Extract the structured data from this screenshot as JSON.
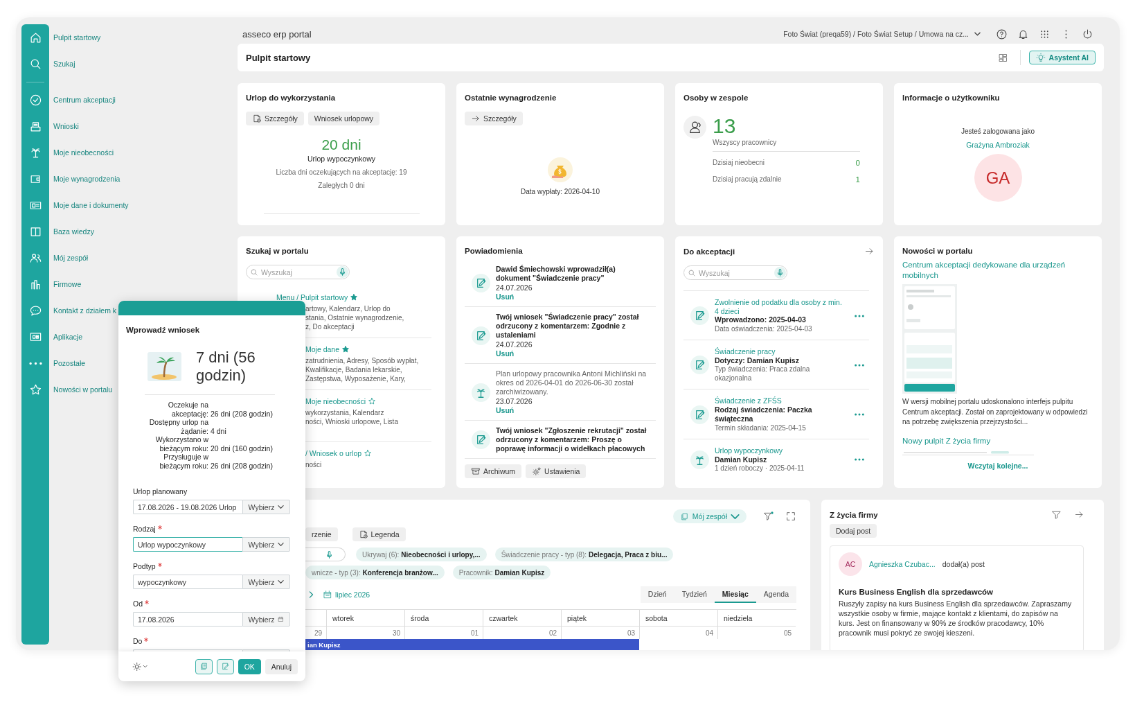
{
  "sidebar": {
    "items": [
      {
        "label": "Pulpit startowy"
      },
      {
        "label": "Szukaj"
      },
      {
        "label": "Centrum akceptacji"
      },
      {
        "label": "Wnioski"
      },
      {
        "label": "Moje nieobecności"
      },
      {
        "label": "Moje wynagrodzenia"
      },
      {
        "label": "Moje dane i dokumenty"
      },
      {
        "label": "Baza wiedzy"
      },
      {
        "label": "Mój zespół"
      },
      {
        "label": "Firmowe"
      },
      {
        "label": "Kontakt z działem k"
      },
      {
        "label": "Aplikacje"
      },
      {
        "label": "Pozostałe"
      },
      {
        "label": "Nowości w portalu"
      }
    ]
  },
  "topbar": {
    "logo": "asseco erp portal",
    "context": "Foto Świat (preqa59) / Foto Świat Setup / Umowa na cz..."
  },
  "header": {
    "title": "Pulpit startowy",
    "assistant_button": "Asystent AI"
  },
  "leave_card": {
    "title": "Urlop do wykorzystania",
    "details_button": "Szczegóły",
    "request_button": "Wniosek urlopowy",
    "amount": "20 dni",
    "type": "Urlop wypoczynkowy",
    "pending": "Liczba dni oczekujących na akceptację: 19",
    "overdue": "Zaległych 0 dni"
  },
  "salary_card": {
    "title": "Ostatnie wynagrodzenie",
    "details_button": "Szczegóły",
    "payday": "Data wypłaty: 2026-04-10"
  },
  "team_card": {
    "title": "Osoby w zespole",
    "count": "13",
    "count_label": "Wszyscy pracownicy",
    "stats": [
      {
        "label": "Dzisiaj nieobecni",
        "value": "0"
      },
      {
        "label": "Dzisiaj pracują zdalnie",
        "value": "1"
      }
    ]
  },
  "user_card": {
    "title": "Informacje o użytkowniku",
    "caption": "Jesteś zalogowana jako",
    "name": "Grażyna Ambroziak",
    "initials": "GA"
  },
  "portal_search": {
    "title": "Szukaj w portalu",
    "placeholder": "Wyszukaj",
    "results": [
      {
        "title": "Menu / Pulpit startowy",
        "favorite": true,
        "description": "artowy, Kalendarz, Urlop do\nstania, Ostatnie wynagrodzenie,\nz, Do akceptacji"
      },
      {
        "title": "Moje dane",
        "favorite": true,
        "description": "zatrudnienia, Adresy, Sposób wypłat,\nKwalifikacje, Badania lekarskie,\nZastępstwa, Wyposażenie, Kary,"
      },
      {
        "title": "Moje nieobecności",
        "favorite": false,
        "description": "wykorzystania, Kalendarz\nności, Wnioski urlopowe, Lista"
      },
      {
        "title": "/ Wniosek o urlop",
        "favorite": false,
        "description": "ności"
      }
    ]
  },
  "notifications": {
    "title": "Powiadomienia",
    "items": [
      {
        "kind": "document",
        "text": "Dawid Śmiechowski wprowadził(a) dokument \"Świadczenie pracy\"",
        "date": "24.07.2026",
        "action": "Usuń",
        "read": false
      },
      {
        "kind": "document",
        "text": "Twój wniosek \"Świadczenie pracy\" został odrzucony z komentarzem: Zgodnie z ustaleniami",
        "date": "24.07.2026",
        "action": "Usuń",
        "read": false
      },
      {
        "kind": "leave",
        "text": "Plan urlopowy pracownika Antoni Michliński na okres od 2026-04-01 do 2026-06-30 został zarchiwizowany.",
        "date": "23.07.2026",
        "action": "Usuń",
        "read": true
      },
      {
        "kind": "document",
        "text": "Twój wniosek \"Zgłoszenie rekrutacji\" został odrzucony z komentarzem: Proszę o poprawę informacji o widełkach płacowych",
        "read": false
      }
    ],
    "archive_button": "Archiwum",
    "settings_button": "Ustawienia"
  },
  "approvals": {
    "title": "Do akceptacji",
    "placeholder": "Wyszukaj",
    "items": [
      {
        "kind": "document",
        "title": "Zwolnienie od podatku dla osoby z min. 4 dzieci",
        "subtitle": "Wprowadzono: 2025-04-03",
        "detail": "Data oświadczenia: 2025-04-03"
      },
      {
        "kind": "document",
        "title": "Świadczenie pracy",
        "subtitle": "Dotyczy: Damian Kupisz",
        "detail": "Typ świadczenia: Praca zdalna okazjonalna"
      },
      {
        "kind": "document",
        "title": "Świadczenie z ZFŚS",
        "subtitle": "Rodzaj świadczenia: Paczka świąteczna",
        "detail": "Termin składania: 2025-04-15"
      },
      {
        "kind": "leave",
        "title": "Urlop wypoczynkowy",
        "subtitle": "Damian Kupisz",
        "detail": "1 dzień roboczy · 2025-04-11"
      }
    ]
  },
  "news": {
    "title": "Nowości w portalu",
    "items": [
      {
        "title": "Centrum akceptacji dedykowane dla urządzeń mobilnych",
        "summary": "W wersji mobilnej portalu udoskonalono interfejs pulpitu Centrum akceptacji. Został on zaprojektowany w odpowiedzi na potrzebę zwiększenia przejrzystości..."
      },
      {
        "title": "Nowy pulpit Z życia firmy"
      }
    ],
    "more": "Wczytaj kolejne..."
  },
  "calendar": {
    "team_filter": "Mój zespół",
    "highlight_button": "rzenie",
    "legend_button": "Legenda",
    "filters": [
      {
        "label": "Ukrywaj (6):",
        "value": "Nieobecności i urlopy,..."
      },
      {
        "label": "Świadczenie pracy - typ (8):",
        "value": "Delegacja, Praca z biu..."
      },
      {
        "label": "wnicze - typ (3):",
        "value": "Konferencja branżow..."
      },
      {
        "label": "Pracownik:",
        "value": "Damian Kupisz"
      }
    ],
    "month": "lipiec 2026",
    "views": [
      {
        "label": "Dzień",
        "selected": false
      },
      {
        "label": "Tydzień",
        "selected": false
      },
      {
        "label": "Miesiąc",
        "selected": true
      },
      {
        "label": "Agenda",
        "selected": false
      }
    ],
    "weekdays": [
      "wtorek",
      "środa",
      "czwartek",
      "piątek",
      "sobota",
      "niedziela"
    ],
    "days": [
      "29",
      "30",
      "01",
      "02",
      "03",
      "04",
      "05"
    ],
    "event": "ian Kupisz"
  },
  "company_life": {
    "title": "Z życia firmy",
    "add_button": "Dodaj post",
    "post": {
      "initials": "AC",
      "author": "Agnieszka Czubac...",
      "action": "dodał(a) post",
      "title": "Kurs Business English dla sprzedawców",
      "body": "Ruszyły zapisy na kurs Business English dla sprzedawców. Zapraszamy wszystkie osoby w firmie, mające kontakt z klientami, do zapisów na kurs. Jest on finansowany w 90% ze środków pracodawcy, 10% pracownik musi pokryć ze swojej kieszeni."
    }
  },
  "dialog": {
    "title": "Wprowadź wniosek",
    "summary": "7 dni (56 godzin)",
    "balances": [
      {
        "label": "Oczekuje na akceptację:",
        "value": "26 dni (208 godzin)"
      },
      {
        "label": "Dostępny urlop na żądanie:",
        "value": "4 dni"
      },
      {
        "label": "Wykorzystano w bieżącym roku:",
        "value": "20 dni (160 godzin)"
      },
      {
        "label": "Przysługuje w bieżącym roku:",
        "value": "26 dni (208 godzin)"
      }
    ],
    "fields": [
      {
        "kind": "select",
        "label": "Urlop planowany",
        "required": false,
        "focused": false,
        "value": "17.08.2026 - 19.08.2026 Urlop",
        "picker": "Wybierz"
      },
      {
        "kind": "select",
        "label": "Rodzaj",
        "required": true,
        "focused": true,
        "value": "Urlop wypoczynkowy",
        "picker": "Wybierz"
      },
      {
        "kind": "select",
        "label": "Podtyp",
        "required": true,
        "focused": false,
        "value": "wypoczynkowy",
        "picker": "Wybierz"
      },
      {
        "kind": "date",
        "label": "Od",
        "required": true,
        "focused": false,
        "value": "17.08.2026",
        "picker": "Wybierz"
      },
      {
        "label": "Do",
        "required": true
      }
    ],
    "ok_button": "OK",
    "cancel_button": "Anuluj"
  }
}
